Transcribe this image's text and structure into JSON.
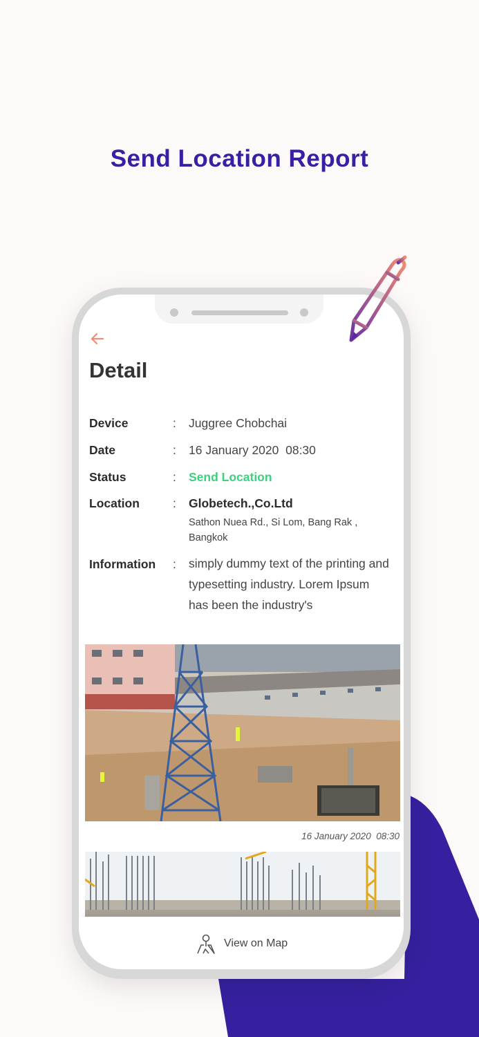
{
  "promo": {
    "title": "Send Location Report"
  },
  "colors": {
    "brand": "#3620a4",
    "accent_back": "#f08d78",
    "status_green": "#3ed07c"
  },
  "icons": {
    "back": "arrow-left-icon",
    "map": "map-pin-icon",
    "pencil": "pencil-icon"
  },
  "screen": {
    "title": "Detail",
    "fields": {
      "device": {
        "label": "Device",
        "colon": ":",
        "value": "Juggree Chobchai"
      },
      "date": {
        "label": "Date",
        "colon": ":",
        "value": "16 January 2020  08:30"
      },
      "status": {
        "label": "Status",
        "colon": ":",
        "value": "Send Location"
      },
      "location": {
        "label": "Location",
        "colon": ":",
        "value": "Globetech.,Co.Ltd",
        "address": "Sathon Nuea Rd., Si Lom,  Bang Rak , Bangkok"
      },
      "information": {
        "label": "Information",
        "colon": ":",
        "value": "simply dummy text of the printing and typesetting industry. Lorem Ipsum has been the industry's"
      }
    },
    "photos": [
      {
        "timestamp": "16 January 2020  08:30"
      }
    ],
    "bottom": {
      "view_map_label": "View on Map"
    }
  }
}
